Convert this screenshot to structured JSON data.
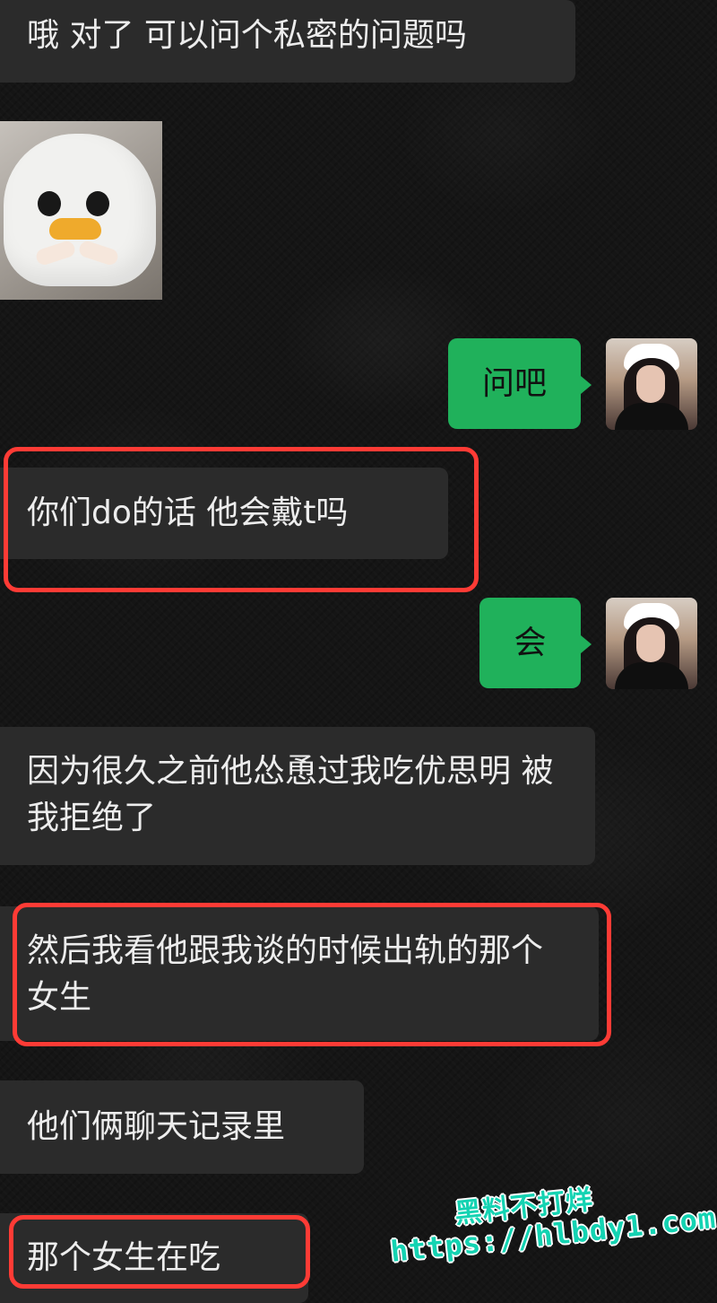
{
  "chat": {
    "messages": [
      {
        "text": "哦 对了 可以问个私密的问题吗",
        "sender": "other",
        "highlighted": false
      },
      {
        "text": "",
        "sender": "other",
        "type": "sticker",
        "image": "duck-sticker"
      },
      {
        "text": "问吧",
        "sender": "self",
        "highlighted": false
      },
      {
        "text": "你们do的话 他会戴t吗",
        "sender": "other",
        "highlighted": true
      },
      {
        "text": "会",
        "sender": "self",
        "highlighted": false
      },
      {
        "text": "因为很久之前他怂恿过我吃优思明 被我拒绝了",
        "sender": "other",
        "highlighted": false
      },
      {
        "text": "然后我看他跟我谈的时候出轨的那个女生",
        "sender": "other",
        "highlighted": true
      },
      {
        "text": "他们俩聊天记录里",
        "sender": "other",
        "highlighted": false
      },
      {
        "text": "那个女生在吃",
        "sender": "other",
        "highlighted": true
      }
    ]
  },
  "watermark": {
    "line_1": "黑料不打烊",
    "line_2": "https://hlbdy1.com"
  },
  "colors": {
    "background": "#151515",
    "incoming_bubble": "#2b2b2b",
    "outgoing_bubble": "#20b15b",
    "highlight": "#ff3b35",
    "watermark": "#14d3b2"
  },
  "icons": {
    "sticker": "duck-sticker",
    "avatar": "user-avatar"
  }
}
